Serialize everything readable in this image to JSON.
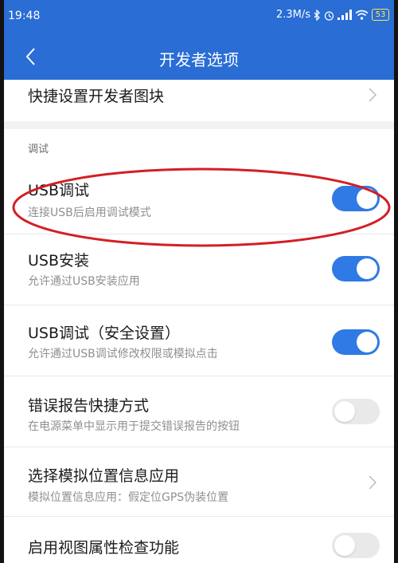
{
  "status_bar": {
    "time": "19:48",
    "network_speed": "2.3M/s",
    "battery": "53",
    "icons": [
      "bluetooth-icon",
      "alarm-icon",
      "signal-icon",
      "wifi-icon",
      "battery-icon"
    ]
  },
  "header": {
    "title": "开发者选项",
    "back_icon": "chevron-left-icon"
  },
  "quick_settings_row": {
    "title": "快捷设置开发者图块"
  },
  "section": {
    "label": "调试"
  },
  "settings": [
    {
      "title": "USB调试",
      "subtitle": "连接USB后启用调试模式",
      "control": "toggle",
      "on": true
    },
    {
      "title": "USB安装",
      "subtitle": "允许通过USB安装应用",
      "control": "toggle",
      "on": true
    },
    {
      "title": "USB调试（安全设置）",
      "subtitle": "允许通过USB调试修改权限或模拟点击",
      "control": "toggle",
      "on": true
    },
    {
      "title": "错误报告快捷方式",
      "subtitle": "在电源菜单中显示用于提交错误报告的按钮",
      "control": "toggle",
      "on": false
    },
    {
      "title": "选择模拟位置信息应用",
      "subtitle": "模拟位置信息应用：假定位GPS伪装位置",
      "control": "chevron"
    },
    {
      "title": "启用视图属性检查功能",
      "subtitle": "",
      "control": "toggle",
      "on": false
    }
  ],
  "colors": {
    "header": "#2a6dd5",
    "toggle_on": "#2f7ae5",
    "toggle_off": "#e9e9e9",
    "annotation": "#d31f24"
  }
}
